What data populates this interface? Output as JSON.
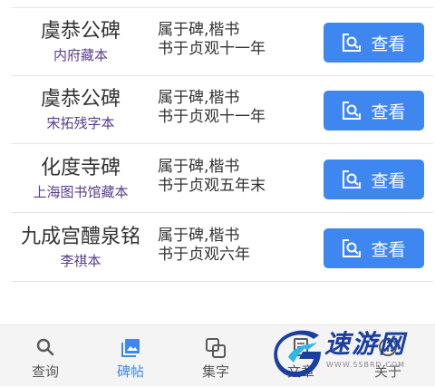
{
  "rows": [
    {
      "name": "虞恭公碑",
      "edition": "内府藏本",
      "desc1": "属于碑,楷书",
      "desc2": "书于贞观十一年",
      "button": "查看"
    },
    {
      "name": "虞恭公碑",
      "edition": "宋拓残字本",
      "desc1": "属于碑,楷书",
      "desc2": "书于贞观十一年",
      "button": "查看"
    },
    {
      "name": "化度寺碑",
      "edition": "上海图书馆藏本",
      "desc1": "属于碑,楷书",
      "desc2": "书于贞观五年末",
      "button": "查看"
    },
    {
      "name": "九成宫醴泉铭",
      "edition": "李祺本",
      "desc1": "属于碑,楷书",
      "desc2": "书于贞观六年",
      "button": "查看"
    }
  ],
  "tabs": [
    {
      "label": "查询",
      "icon": "search-icon",
      "active": false
    },
    {
      "label": "碑帖",
      "icon": "image-icon",
      "active": true
    },
    {
      "label": "集字",
      "icon": "overlap-squares-icon",
      "active": false
    },
    {
      "label": "文章",
      "icon": "document-icon",
      "active": false
    },
    {
      "label": "关于",
      "icon": "info-icon",
      "active": false
    }
  ],
  "watermark": {
    "text": "速游网",
    "url": "WWW.SSBRD.COM"
  },
  "colors": {
    "accent": "#3f87f0",
    "edition": "#5a3c8c",
    "text": "#333333",
    "tab_inactive": "#5a5a5a",
    "tabbar_bg": "#f4f4f4"
  }
}
